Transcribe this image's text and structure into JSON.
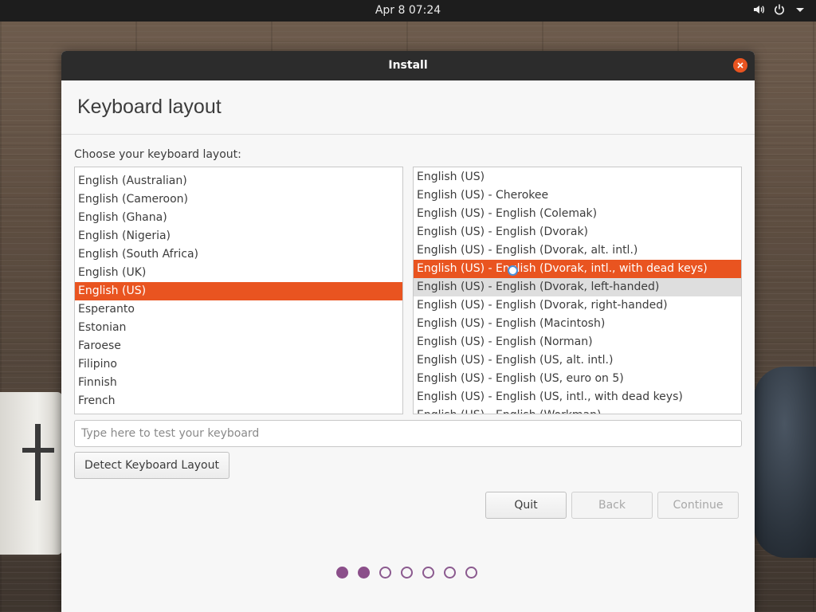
{
  "topbar": {
    "clock": "Apr 8  07:24"
  },
  "window": {
    "title": "Install"
  },
  "page": {
    "title": "Keyboard layout",
    "prompt": "Choose your keyboard layout:"
  },
  "layouts": [
    {
      "label": "English (Australian)"
    },
    {
      "label": "English (Cameroon)"
    },
    {
      "label": "English (Ghana)"
    },
    {
      "label": "English (Nigeria)"
    },
    {
      "label": "English (South Africa)"
    },
    {
      "label": "English (UK)"
    },
    {
      "label": "English (US)"
    },
    {
      "label": "Esperanto"
    },
    {
      "label": "Estonian"
    },
    {
      "label": "Faroese"
    },
    {
      "label": "Filipino"
    },
    {
      "label": "Finnish"
    },
    {
      "label": "French"
    }
  ],
  "selected_layout": "English (US)",
  "variants": [
    {
      "label": "English (US)"
    },
    {
      "label": "English (US) - Cherokee"
    },
    {
      "label": "English (US) - English (Colemak)"
    },
    {
      "label": "English (US) - English (Dvorak)"
    },
    {
      "label": "English (US) - English (Dvorak, alt. intl.)"
    },
    {
      "label": "English (US) - English (Dvorak, intl., with dead keys)"
    },
    {
      "label": "English (US) - English (Dvorak, left-handed)"
    },
    {
      "label": "English (US) - English (Dvorak, right-handed)"
    },
    {
      "label": "English (US) - English (Macintosh)"
    },
    {
      "label": "English (US) - English (Norman)"
    },
    {
      "label": "English (US) - English (US, alt. intl.)"
    },
    {
      "label": "English (US) - English (US, euro on 5)"
    },
    {
      "label": "English (US) - English (US, intl., with dead keys)"
    },
    {
      "label": "English (US) - English (Workman)"
    }
  ],
  "selected_variant": "English (US) - English (Dvorak, intl., with dead keys)",
  "hovered_variant": "English (US) - English (Dvorak, left-handed)",
  "test_input": {
    "placeholder": "Type here to test your keyboard",
    "value": ""
  },
  "buttons": {
    "detect": "Detect Keyboard Layout",
    "quit": "Quit",
    "back": "Back",
    "continue": "Continue"
  },
  "progress": {
    "total_steps": 7,
    "completed_steps": 2
  },
  "colors": {
    "accent": "#e95420",
    "progress": "#8b4f8a",
    "titlebar": "#2c2c2c"
  },
  "icons": {
    "volume": "volume-icon",
    "power": "power-icon",
    "menu": "chevron-down-icon",
    "close": "close-icon"
  }
}
